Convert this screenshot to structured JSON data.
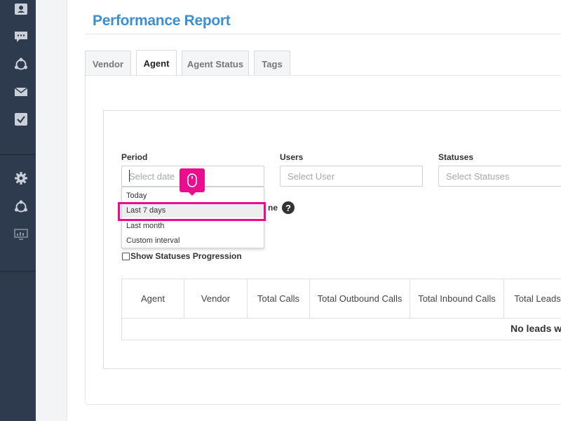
{
  "sidebar": {
    "icons": [
      "contacts-icon",
      "chat-icon",
      "share-icon",
      "mail-icon",
      "check-icon",
      "gear-icon",
      "share-icon",
      "monitor-icon"
    ]
  },
  "page": {
    "title": "Performance Report"
  },
  "tabs": [
    {
      "label": "Vendor",
      "active": false
    },
    {
      "label": "Agent",
      "active": true
    },
    {
      "label": "Agent Status",
      "active": false
    },
    {
      "label": "Tags",
      "active": false
    }
  ],
  "filters": {
    "period": {
      "label": "Period",
      "placeholder": "Select date"
    },
    "users": {
      "label": "Users",
      "placeholder": "Select User"
    },
    "statuses": {
      "label": "Statuses",
      "placeholder": "Select Statuses"
    }
  },
  "period_dropdown": {
    "options": [
      "Today",
      "Last 7 days",
      "Last month",
      "Custom interval"
    ],
    "highlighted": "Last 7 days"
  },
  "partial_label": "ne",
  "checkbox": {
    "label": "Show Statuses Progression",
    "checked": false
  },
  "table": {
    "headers": [
      "Agent",
      "Vendor",
      "Total Calls",
      "Total Outbound Calls",
      "Total Inbound Calls",
      "Total Leads"
    ],
    "empty_message": "No leads we"
  },
  "colors": {
    "sidebar": "#2e3b4e",
    "title": "#3d8fd0",
    "highlight": "#ec0d8e"
  }
}
